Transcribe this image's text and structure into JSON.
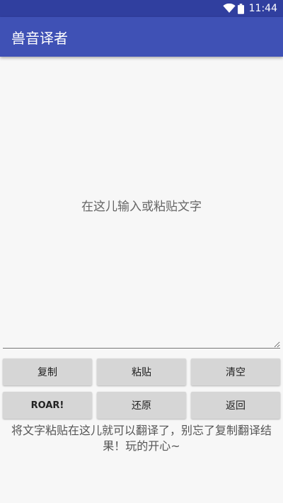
{
  "status_bar": {
    "time": "11:44",
    "wifi_icon": "wifi-icon",
    "battery_icon": "battery-icon"
  },
  "app_bar": {
    "title": "兽音译者"
  },
  "editor": {
    "placeholder": "在这儿输入或粘贴文字",
    "value": ""
  },
  "buttons": {
    "copy": "复制",
    "paste": "粘贴",
    "clear": "清空",
    "roar": "ROAR!",
    "restore": "还原",
    "back": "返回"
  },
  "hint": "将文字粘贴在这儿就可以翻译了，别忘了复制翻译结果！玩的开心~",
  "colors": {
    "status_bar": "#303f9f",
    "app_bar": "#3f51b5",
    "button": "#d6d6d6",
    "background": "#f7f7f7"
  }
}
